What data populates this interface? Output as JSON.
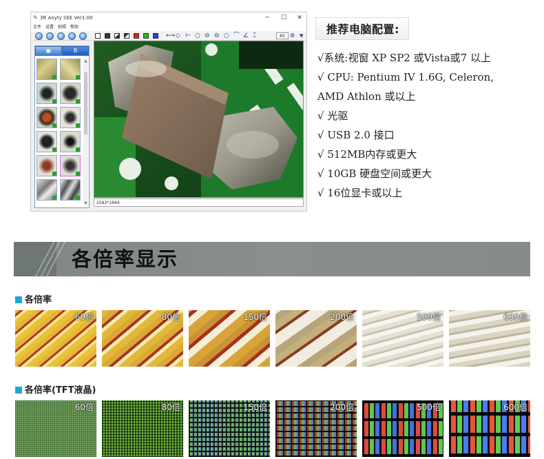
{
  "app": {
    "title": "3R Anyty SEE Ver1.00",
    "menu": [
      "文件",
      "设置",
      "拍照",
      "帮助"
    ],
    "window_controls": [
      "─",
      "☐",
      "✕"
    ],
    "zoom_value": "60",
    "tabs": [
      "▣",
      "B"
    ],
    "status_resolution": "2592*1944",
    "toolbar_tools": [
      "⟷",
      "◇",
      "⊢",
      "○",
      "⊖",
      "⊖",
      "○",
      "⌒",
      "∠",
      "⌶"
    ]
  },
  "specs": {
    "heading": "推荐电脑配置:",
    "lines": [
      "√系统:视窗 XP SP2 或Vista或7 以上",
      "√  CPU: Pentium IV 1.6G, Celeron,",
      "AMD Athlon 或以上",
      "√  光驱",
      "√  USB 2.0 接口",
      "√  512MB内存或更大",
      "√  10GB 硬盘空间或更大",
      "√  16位显卡或以上"
    ]
  },
  "banner": {
    "title": "各倍率显示"
  },
  "sections": [
    {
      "label": "各倍率",
      "images": [
        {
          "mag": "60倍"
        },
        {
          "mag": "80倍"
        },
        {
          "mag": "150倍"
        },
        {
          "mag": "200倍"
        },
        {
          "mag": "500倍"
        },
        {
          "mag": "600倍"
        }
      ]
    },
    {
      "label": "各倍率(TFT液晶)",
      "images": [
        {
          "mag": "60倍"
        },
        {
          "mag": "80倍"
        },
        {
          "mag": "150倍"
        },
        {
          "mag": "200倍"
        },
        {
          "mag": "500倍"
        },
        {
          "mag": "600倍"
        }
      ]
    }
  ],
  "colors": {
    "accent": "#1ea7d6",
    "banner": "#878d8a",
    "window_blue": "#3b7fcf"
  }
}
